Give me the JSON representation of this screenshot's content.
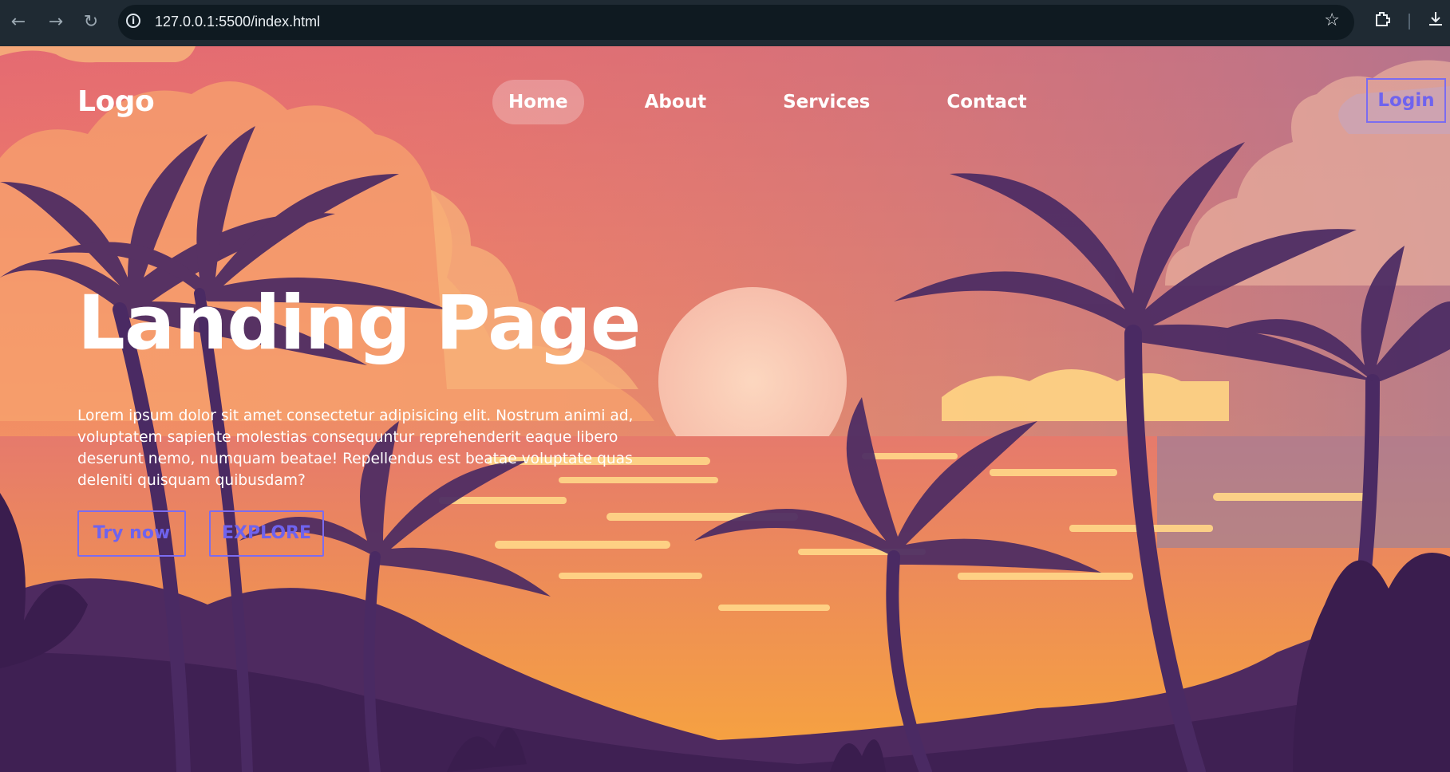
{
  "browser": {
    "back_icon": "arrow-left-icon",
    "forward_icon": "arrow-right-icon",
    "reload_icon": "reload-icon",
    "info_icon": "info-icon",
    "url": "127.0.0.1:5500/index.html",
    "bookmark_icon": "star-icon",
    "extensions_icon": "puzzle-icon",
    "download_icon": "download-icon"
  },
  "header": {
    "logo": "Logo",
    "nav": [
      {
        "label": "Home",
        "active": true
      },
      {
        "label": "About",
        "active": false
      },
      {
        "label": "Services",
        "active": false
      },
      {
        "label": "Contact",
        "active": false
      }
    ],
    "login_label": "Login"
  },
  "hero": {
    "title": "Landing Page",
    "body": "Lorem ipsum dolor sit amet consectetur adipisicing elit. Nostrum animi ad, voluptatem sapiente molestias consequuntur reprehenderit eaque libero deserunt nemo, numquam beatae! Repellendus est beatae voluptate quas deleniti quisquam quibusdam?",
    "try_label": "Try now",
    "explore_label": "EXPLORE"
  },
  "colors": {
    "accent": "#7b6cf0",
    "sky_top": "#e8706c",
    "sky_mid": "#f2856a",
    "sun_glow": "#ffd07a",
    "palm": "#4a2a63"
  }
}
